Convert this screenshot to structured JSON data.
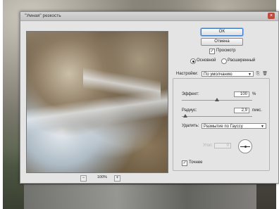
{
  "dialog": {
    "title": "\"Умная\" резкость",
    "close_glyph": "×"
  },
  "buttons": {
    "ok": "OK",
    "cancel": "Отмена"
  },
  "preview": {
    "label": "Просмотр",
    "checked": true,
    "zoom": "100%",
    "zoom_out": "−",
    "zoom_in": "+"
  },
  "mode": {
    "basic": "Основной",
    "advanced": "Расширенный",
    "selected": "basic"
  },
  "settings": {
    "label": "Настройки:",
    "value": "По умолчанию"
  },
  "effect": {
    "label": "Эффект:",
    "value": "100",
    "unit": "%",
    "fraction": 0.5
  },
  "radius": {
    "label": "Радиус:",
    "value": "2,9",
    "unit": "пикс.",
    "fraction": 0.05
  },
  "remove": {
    "label": "Удалить:",
    "value": "Размытие по Гауссу"
  },
  "angle": {
    "label": "Угол:",
    "value": "0"
  },
  "more_accurate": {
    "label": "Точнее",
    "checked": true
  },
  "colors": {
    "ok_border": "#3d7bc6"
  },
  "icons": [
    "save-settings-icon",
    "delete-settings-icon",
    "angle-dial-icon"
  ]
}
